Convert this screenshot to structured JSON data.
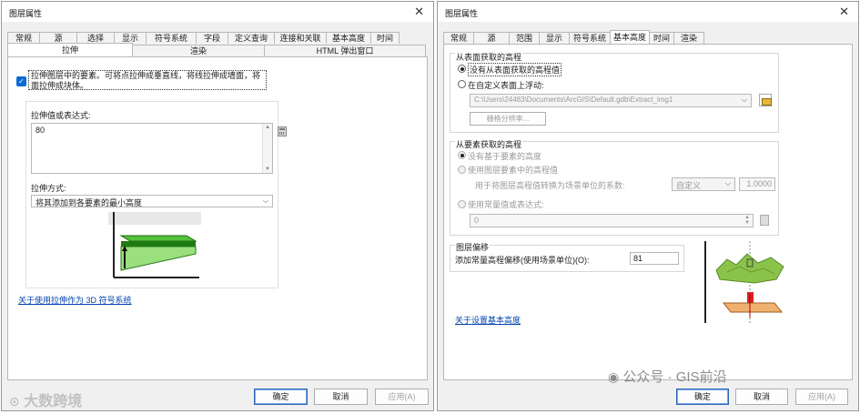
{
  "left": {
    "title": "图层属性",
    "tabs_row1": [
      "常规",
      "源",
      "选择",
      "显示",
      "符号系统",
      "字段",
      "定义查询",
      "连接和关联",
      "基本高度",
      "时间"
    ],
    "tabs_row2": [
      "拉伸",
      "渲染",
      "HTML 弹出窗口"
    ],
    "active_tab": "拉伸",
    "checkbox_label": "拉伸图层中的要素。可将点拉伸成垂直线，将线拉伸成墙面，将面拉伸成块体。",
    "checkbox_checked": true,
    "value_label": "拉伸值或表达式:",
    "value": "80",
    "method_label": "拉伸方式:",
    "method_value": "将其添加到各要素的最小高度",
    "link": "关于使用拉伸作为 3D 符号系统",
    "ok": "确定",
    "cancel": "取消",
    "apply": "应用(A)"
  },
  "right": {
    "title": "图层属性",
    "tabs": [
      "常规",
      "源",
      "范围",
      "显示",
      "符号系统",
      "基本高度",
      "时间",
      "渲染"
    ],
    "active_tab": "基本高度",
    "surface_group": "从表面获取的高程",
    "radio_no_surface": "没有从表面获取的高程值",
    "radio_float": "在自定义表面上浮动:",
    "surface_path": "C:\\Users\\24483\\Documents\\ArcGIS\\Default.gdb\\Extract_img1",
    "raster_res_button": "栅格分辨率...",
    "feature_group": "从要素获取的高程",
    "radio_no_feature": "没有基于要素的高度",
    "radio_use_feature": "使用图层要素中的高程值",
    "factor_label": "用于将图层高程值转换为场景单位的系数:",
    "factor_unit": "自定义",
    "factor_value": "1.0000",
    "radio_constant": "使用常量值或表达式:",
    "constant_value": "0",
    "offset_group": "图层偏移",
    "offset_label": "添加常量高程偏移(使用场景单位)(O):",
    "offset_value": "81",
    "link": "关于设置基本高度",
    "ok": "确定",
    "cancel": "取消",
    "apply": "应用(A)"
  },
  "watermark_left": "大数跨境",
  "watermark_right": "公众号 · GIS前沿",
  "colors": {
    "accent": "#0a6ad6",
    "link": "#0645ad",
    "green": "#3a9a1f"
  }
}
